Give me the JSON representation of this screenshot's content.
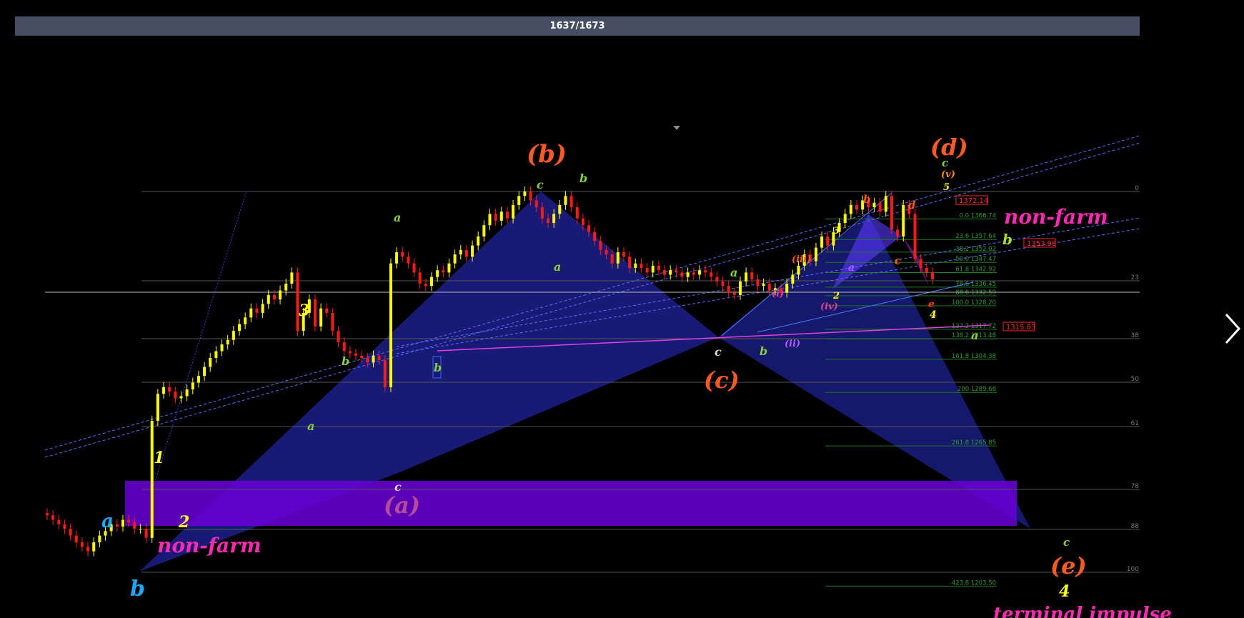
{
  "header": {
    "counter": "1637/1673"
  },
  "colors": {
    "background": "#000000",
    "bull_candle": "#ffff00",
    "bear_candle": "#ff1a1a",
    "pattern_fill": "#2b2fd6",
    "zone_fill": "#6a00d9",
    "channel": "#4a5cff",
    "trendline": "#e040e0",
    "fib_line": "#1f7a1f",
    "level_line": "#555555"
  },
  "chart_data": {
    "type": "candlestick",
    "title": "",
    "xlabel": "",
    "ylabel": "",
    "price_close": [
      1228,
      1226,
      1224,
      1222,
      1219,
      1216,
      1214,
      1212,
      1216,
      1219,
      1221,
      1224,
      1223,
      1226,
      1225,
      1222,
      1222,
      1218,
      1270,
      1282,
      1285,
      1283,
      1280,
      1281,
      1284,
      1287,
      1290,
      1294,
      1298,
      1301,
      1304,
      1306,
      1310,
      1313,
      1316,
      1320,
      1318,
      1322,
      1326,
      1324,
      1328,
      1331,
      1336,
      1310,
      1318,
      1324,
      1312,
      1320,
      1318,
      1310,
      1305,
      1301,
      1300,
      1299,
      1298,
      1296,
      1299,
      1297,
      1285,
      1340,
      1345,
      1343,
      1340,
      1336,
      1331,
      1330,
      1334,
      1337,
      1336,
      1340,
      1344,
      1346,
      1343,
      1348,
      1352,
      1357,
      1362,
      1359,
      1363,
      1360,
      1366,
      1370,
      1372,
      1368,
      1365,
      1360,
      1358,
      1362,
      1366,
      1370,
      1365,
      1360,
      1357,
      1354,
      1350,
      1346,
      1344,
      1340,
      1345,
      1343,
      1338,
      1340,
      1338,
      1336,
      1339,
      1337,
      1335,
      1337,
      1336,
      1334,
      1336,
      1335,
      1337,
      1336,
      1334,
      1332,
      1330,
      1327,
      1326,
      1332,
      1336,
      1333,
      1330,
      1331,
      1328,
      1329,
      1327,
      1331,
      1335,
      1339,
      1344,
      1341,
      1347,
      1352,
      1348,
      1354,
      1358,
      1362,
      1366,
      1364,
      1368,
      1365,
      1367,
      1363,
      1370,
      1355,
      1352,
      1366,
      1362,
      1342,
      1338,
      1336,
      1333
    ],
    "fib_levels": [
      {
        "label": "0.0 1366.74",
        "price": 1366.74
      },
      {
        "label": "23.6 1357.64",
        "price": 1357.64
      },
      {
        "label": "38.2 1352.02",
        "price": 1352.02
      },
      {
        "label": "50.0 1347.47",
        "price": 1347.47
      },
      {
        "label": "61.8 1342.92",
        "price": 1342.92
      },
      {
        "label": "78.6 1336.45",
        "price": 1336.45
      },
      {
        "label": "88.6 1332.59",
        "price": 1332.59
      },
      {
        "label": "100.0 1328.20",
        "price": 1328.2
      },
      {
        "label": "127.2 1317.72",
        "price": 1317.72
      },
      {
        "label": "138.2 1313.48",
        "price": 1313.48
      },
      {
        "label": "161.8 1304.38",
        "price": 1304.38
      },
      {
        "label": "200 1289.66",
        "price": 1289.66
      },
      {
        "label": "261.8 1265.85",
        "price": 1265.85
      },
      {
        "label": "423.6 1203.50",
        "price": 1203.5
      }
    ],
    "level_lines": [
      {
        "label": "0"
      },
      {
        "label": "23"
      },
      {
        "label": "38"
      },
      {
        "label": "50"
      },
      {
        "label": "61"
      },
      {
        "label": "78"
      },
      {
        "label": "88"
      },
      {
        "label": "100"
      }
    ],
    "price_tags": [
      "1372.14",
      "1353.98",
      "1315.83"
    ],
    "annotations": {
      "wave_b_big": "(b)",
      "wave_a_big": "(a)",
      "wave_c_big": "(c)",
      "wave_d_big": "(d)",
      "wave_e_big": "(e)",
      "non_farm_1": "non-farm",
      "non_farm_2": "non-farm",
      "terminal": "terminal impulse",
      "l_a_cyan": "a",
      "l_b_cyan": "b",
      "l_1": "1",
      "l_2": "2",
      "l_3": "3",
      "l_4": "4",
      "l_a_green_1": "a",
      "l_b_green_1": "b",
      "l_a_green_2": "a",
      "l_a_green_3": "a",
      "l_c_white_1": "c",
      "l_b_boxed": "b",
      "l_c_green_top": "c",
      "l_b_green_top": "b",
      "l_a_green_4": "a",
      "l_c_white_2": "c",
      "l_b_green_2": "b",
      "l_a_green_5": "a",
      "l_i": "(i)",
      "l_ii": "(ii)",
      "l_iii": "(iii)",
      "l_iv": "(iv)",
      "l_v": "(v)",
      "l_3_small": "3",
      "l_2_small": "2",
      "l_5_small": "5",
      "l_4_small": "4",
      "l_a_purple": "a",
      "l_b_red": "b",
      "l_c_red": "c",
      "l_d_red": "d",
      "l_e_red": "e",
      "l_b_yellowgreen": "b",
      "l_a_green_6": "a",
      "l_c_green_d": "c",
      "l_c_green_e": "c"
    }
  }
}
